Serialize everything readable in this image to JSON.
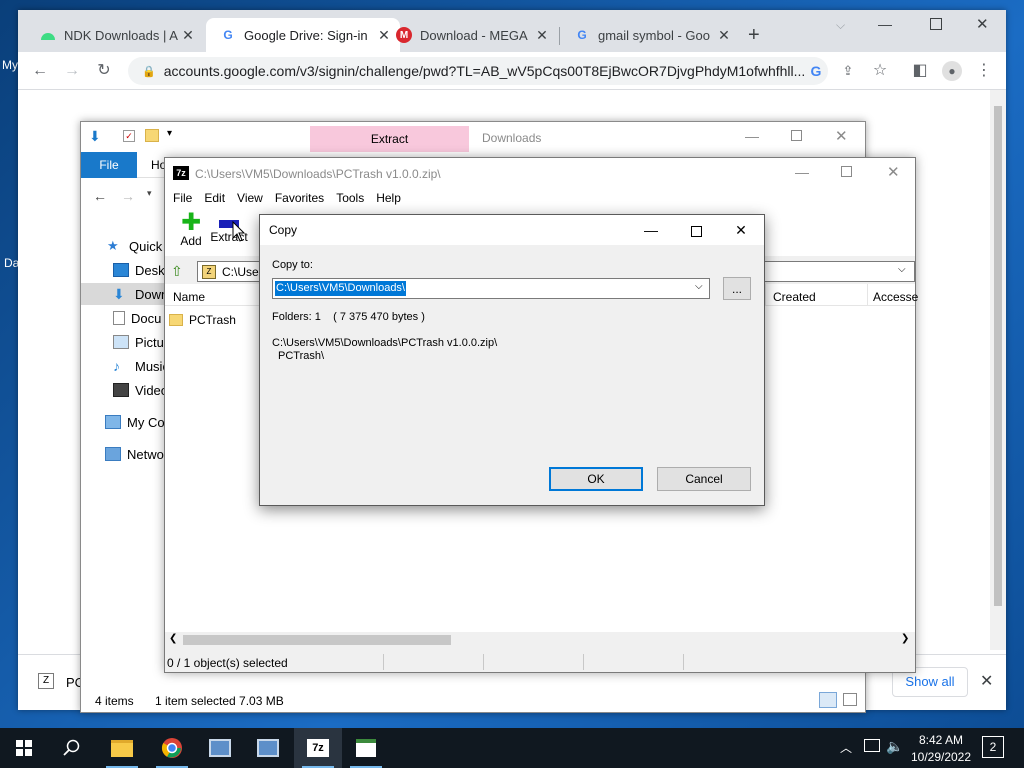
{
  "desktop": {
    "labels": [
      "My",
      "Da"
    ]
  },
  "chrome": {
    "tabs": [
      {
        "title": "NDK Downloads | A",
        "icon": "android-icon",
        "active": false
      },
      {
        "title": "Google Drive: Sign-in",
        "icon": "google-icon",
        "active": true
      },
      {
        "title": "Download - MEGA",
        "icon": "mega-icon",
        "active": false
      },
      {
        "title": "gmail symbol - Goo",
        "icon": "google-icon",
        "active": false
      }
    ],
    "url": "accounts.google.com/v3/signin/challenge/pwd?TL=AB_wV5pCqs00T8EjBwcOR7DjvgPhdyM1ofwhfhll...",
    "download_item": "PC",
    "show_all": "Show all"
  },
  "explorer": {
    "ribbon_tab_extract": "Extract",
    "title": "Downloads",
    "file_tab": "File",
    "home_tab": "Ho",
    "nav_items": [
      "Quick a",
      "Deskt",
      "Down",
      "Docu",
      "Pictur",
      "Music",
      "Video",
      "My Co",
      "Networ"
    ],
    "status_items": "4 items",
    "status_selected": "1 item selected  7.03 MB"
  },
  "sevenzip": {
    "title": "C:\\Users\\VM5\\Downloads\\PCTrash v1.0.0.zip\\",
    "menu": [
      "File",
      "Edit",
      "View",
      "Favorites",
      "Tools",
      "Help"
    ],
    "tool_add": "Add",
    "tool_extract": "Extract",
    "path": "C:\\User",
    "col_name": "Name",
    "col_created": "Created",
    "col_accessed": "Accesse",
    "rows": [
      {
        "name": "PCTrash"
      }
    ],
    "status": "0 / 1 object(s) selected"
  },
  "copy_dialog": {
    "title": "Copy",
    "copy_to_label": "Copy to:",
    "path_value": "C:\\Users\\VM5\\Downloads\\",
    "browse_label": "...",
    "folders_info": "Folders: 1    ( 7 375 470 bytes )",
    "source_line1": "C:\\Users\\VM5\\Downloads\\PCTrash v1.0.0.zip\\",
    "source_line2": "PCTrash\\",
    "ok_label": "OK",
    "cancel_label": "Cancel"
  },
  "taskbar": {
    "time": "8:42 AM",
    "date": "10/29/2022",
    "notification_count": "2"
  }
}
